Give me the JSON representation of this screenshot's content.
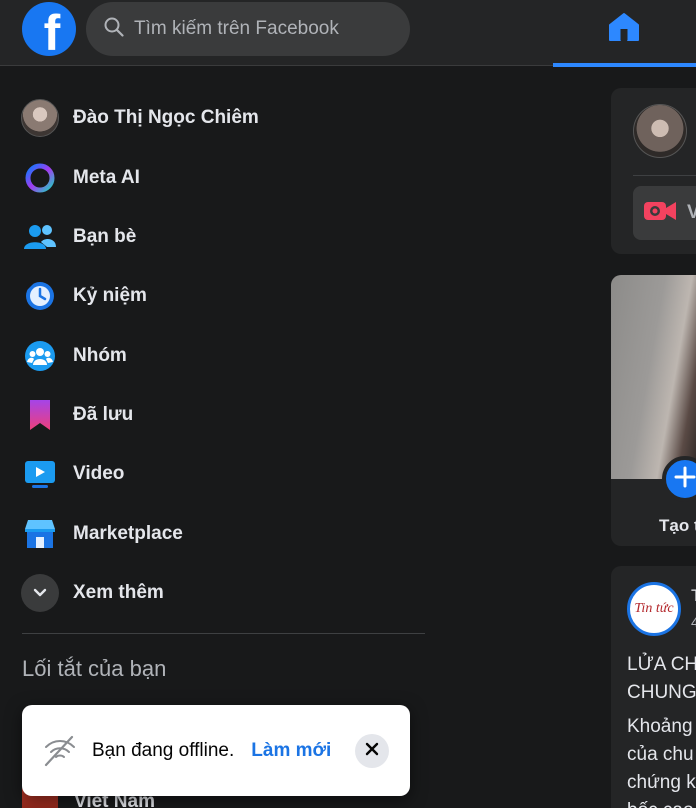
{
  "search": {
    "placeholder": "Tìm kiếm trên Facebook"
  },
  "logo": {
    "letter": "f"
  },
  "nav": {
    "items": [
      {
        "label": "Đào Thị Ngọc Chiêm",
        "icon": "profile-avatar"
      },
      {
        "label": "Meta AI",
        "icon": "meta-ai-icon"
      },
      {
        "label": "Bạn bè",
        "icon": "friends-icon"
      },
      {
        "label": "Kỷ niệm",
        "icon": "memories-icon"
      },
      {
        "label": "Nhóm",
        "icon": "groups-icon"
      },
      {
        "label": "Đã lưu",
        "icon": "saved-icon"
      },
      {
        "label": "Video",
        "icon": "video-icon"
      },
      {
        "label": "Marketplace",
        "icon": "marketplace-icon"
      },
      {
        "label": "Xem thêm",
        "icon": "chevron-down-icon"
      }
    ]
  },
  "shortcuts": {
    "title": "Lối tắt của bạn",
    "partial_item": "Việt Nam"
  },
  "toast": {
    "message": "Bạn đang offline.",
    "action": "Làm mới"
  },
  "composer": {
    "live_label": "V"
  },
  "story": {
    "create_label": "Tạo t"
  },
  "post": {
    "page_logo_text": "Tin tức",
    "header_line1": "T",
    "header_line2": "4",
    "headline_line1": "LỬA CH",
    "headline_line2": "CHUNG",
    "body_line1": "Khoảng",
    "body_line2": "của chu",
    "body_line3": "chứng k",
    "body_line4": "bốc cao"
  },
  "colors": {
    "accent": "#1877f2",
    "background": "#18191a",
    "surface": "#242526"
  }
}
